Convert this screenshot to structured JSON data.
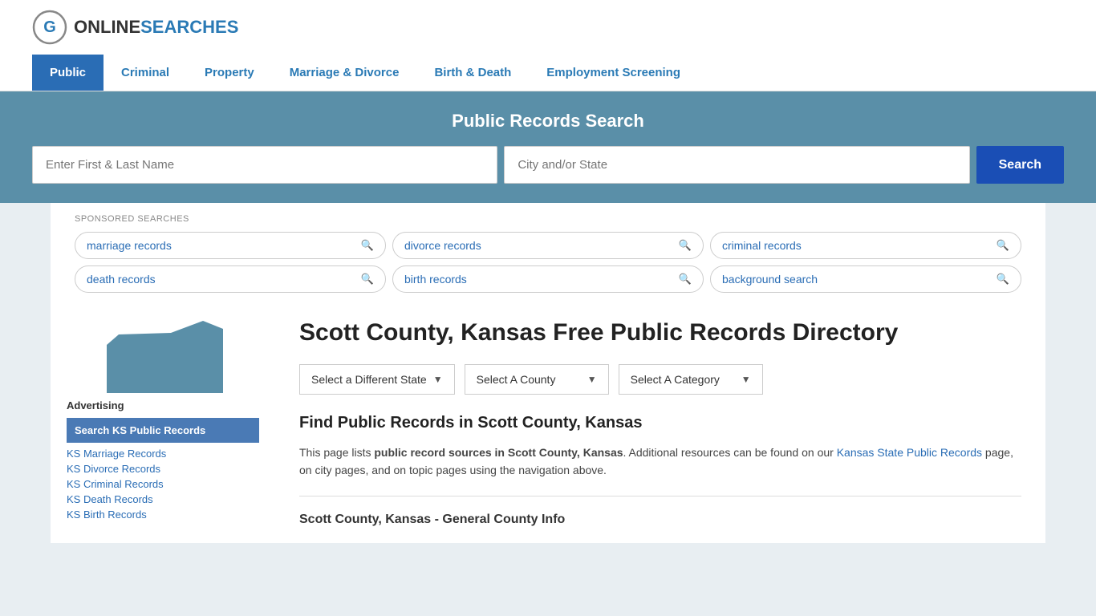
{
  "site": {
    "logo_online": "ONLINE",
    "logo_searches": "SEARCHES"
  },
  "nav": {
    "items": [
      {
        "label": "Public",
        "active": true
      },
      {
        "label": "Criminal",
        "active": false
      },
      {
        "label": "Property",
        "active": false
      },
      {
        "label": "Marriage & Divorce",
        "active": false
      },
      {
        "label": "Birth & Death",
        "active": false
      },
      {
        "label": "Employment Screening",
        "active": false
      }
    ]
  },
  "search_banner": {
    "title": "Public Records Search",
    "name_placeholder": "Enter First & Last Name",
    "location_placeholder": "City and/or State",
    "button_label": "Search"
  },
  "sponsored": {
    "label": "SPONSORED SEARCHES",
    "tags": [
      "marriage records",
      "divorce records",
      "criminal records",
      "death records",
      "birth records",
      "background search"
    ]
  },
  "page": {
    "title": "Scott County, Kansas Free Public Records Directory"
  },
  "dropdowns": {
    "state_label": "Select a Different State",
    "county_label": "Select A County",
    "category_label": "Select A Category"
  },
  "find_records": {
    "title": "Find Public Records in Scott County, Kansas",
    "text_before_bold": "This page lists ",
    "bold_text": "public record sources in Scott County, Kansas",
    "text_after": ". Additional resources can be found on our ",
    "link_text": "Kansas State Public Records",
    "text_end": " page, on city pages, and on topic pages using the navigation above."
  },
  "sidebar": {
    "advertising_label": "Advertising",
    "highlighted_item": "Search KS Public Records",
    "links": [
      "KS Marriage Records",
      "KS Divorce Records",
      "KS Criminal Records",
      "KS Death Records",
      "KS Birth Records"
    ]
  },
  "county_info_title": "Scott County, Kansas - General County Info"
}
